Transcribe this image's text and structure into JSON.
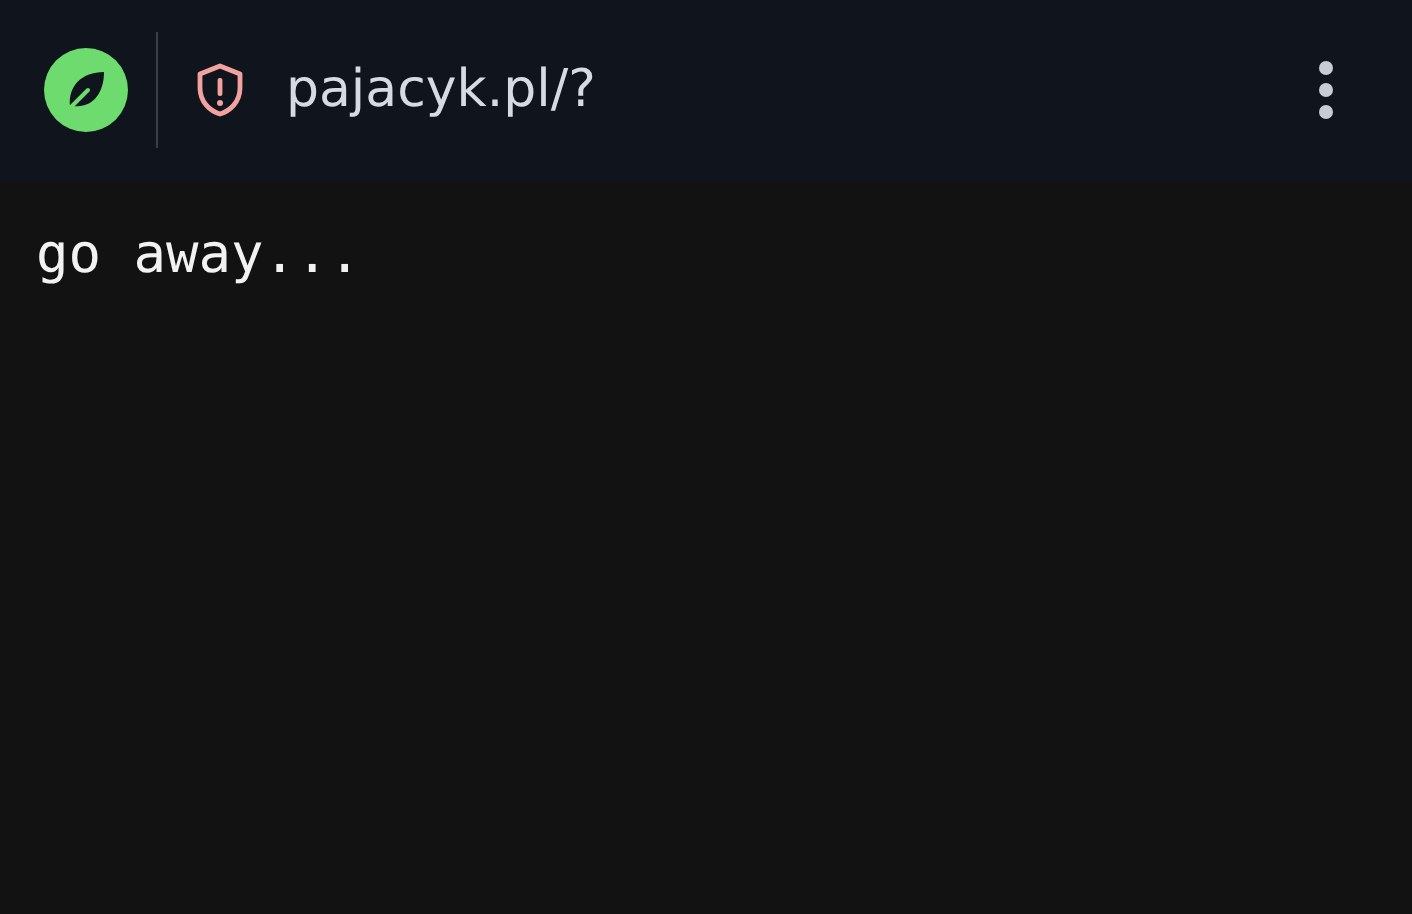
{
  "address_bar": {
    "url": "pajacyk.pl/?"
  },
  "page": {
    "text": "go away..."
  }
}
